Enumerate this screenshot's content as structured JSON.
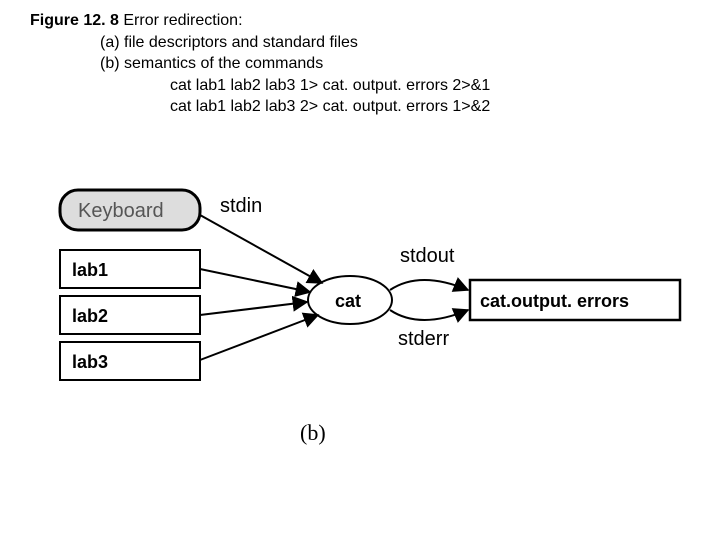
{
  "figure_number": "Figure 12. 8",
  "title": "Error redirection:",
  "line_a": "(a) file descriptors and standard files",
  "line_b": "(b) semantics of the commands",
  "cmd1": "cat lab1 lab2 lab3 1> cat. output. errors 2>&1",
  "cmd2": "cat lab1 lab2 lab3 2> cat. output. errors 1>&2",
  "diagram": {
    "keyboard": "Keyboard",
    "lab1": "lab1",
    "lab2": "lab2",
    "lab3": "lab3",
    "process": "cat",
    "stdin": "stdin",
    "stdout": "stdout",
    "stderr": "stderr",
    "outfile": "cat.output. errors",
    "subfig": "(b)"
  }
}
